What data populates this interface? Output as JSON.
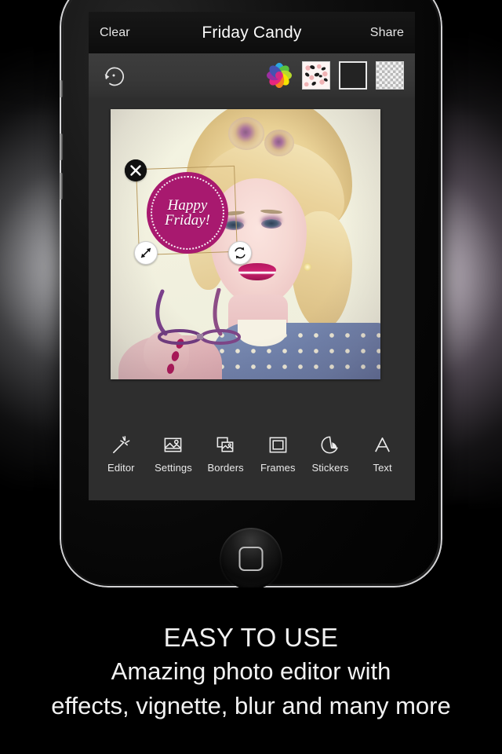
{
  "app": {
    "navbar": {
      "clear_label": "Clear",
      "title": "Friday Candy",
      "share_label": "Share"
    },
    "optionsbar": {
      "undo_icon": "circular-undo-icon",
      "swatches": [
        {
          "name": "color-wheel",
          "label": "Color wheel"
        },
        {
          "name": "pattern",
          "label": "Floral pattern"
        },
        {
          "name": "solid-black",
          "label": "Solid black"
        },
        {
          "name": "transparent",
          "label": "Transparent"
        }
      ]
    },
    "canvas": {
      "photo_alt": "Blonde pin-up woman holding purple eyeglasses in blue polka dot dress",
      "sticker": {
        "line1": "Happy",
        "line2": "Friday!",
        "color": "#a8196f",
        "handles": {
          "delete": "close-icon",
          "scale": "resize-icon",
          "rotate": "rotate-icon"
        }
      }
    },
    "toolbar": {
      "items": [
        {
          "label": "Editor",
          "icon": "magic-wand-icon"
        },
        {
          "label": "Settings",
          "icon": "image-adjust-icon"
        },
        {
          "label": "Borders",
          "icon": "layers-icon"
        },
        {
          "label": "Frames",
          "icon": "frame-square-icon"
        },
        {
          "label": "Stickers",
          "icon": "sticker-peel-icon"
        },
        {
          "label": "Text",
          "icon": "text-a-icon"
        }
      ]
    }
  },
  "device": {
    "home_button": "home-button"
  },
  "caption": {
    "headline": "EASY TO USE",
    "line1": "Amazing photo editor with",
    "line2": "effects, vignette, blur and many more"
  },
  "colors": {
    "accent_magenta": "#a8196f",
    "screen_bg": "#2e2e2e",
    "navbar_bg": "#111111"
  }
}
